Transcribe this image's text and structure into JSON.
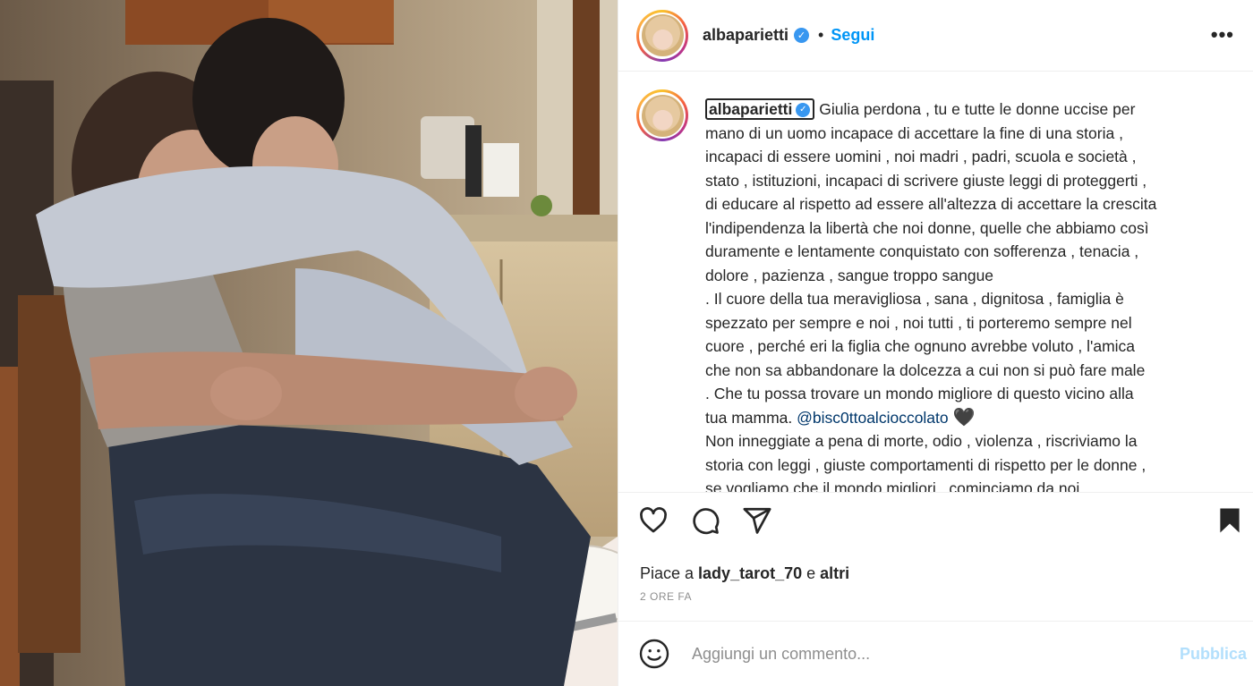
{
  "post": {
    "username": "albaparietti",
    "separator": "•",
    "follow_label": "Segui",
    "more_label": "•••"
  },
  "caption": {
    "username": "albaparietti",
    "lines": [
      "Giulia perdona , tu e tutte le donne uccise per",
      "mano di un uomo incapace di accettare la fine di una storia ,",
      "incapaci di essere uomini , noi madri , padri, scuola e società ,",
      "stato , istituzioni, incapaci di scrivere giuste leggi di proteggerti ,",
      "di educare al rispetto ad essere all'altezza di accettare la crescita",
      "l'indipendenza la libertà che noi donne, quelle che abbiamo così",
      "duramente e lentamente conquistato con sofferenza , tenacia ,",
      "dolore , pazienza , sangue troppo sangue",
      ". Il cuore della tua meravigliosa , sana , dignitosa , famiglia è",
      "spezzato per sempre e noi , noi tutti , ti porteremo sempre nel",
      "cuore , perché eri la figlia che ognuno avrebbe voluto , l'amica",
      "che non sa abbandonare la dolcezza a cui non si può fare male",
      ". Che tu possa trovare un mondo migliore di questo vicino alla"
    ],
    "line14_text": "tua mamma. ",
    "mention": "@bisc0ttoalcioccolato",
    "heart": "🖤",
    "lines_after": [
      "Non inneggiate a pena di morte, odio , violenza , riscriviamo la",
      "storia con leggi , giuste comportamenti di rispetto per le donne ,",
      "se vogliamo che il mondo migliori , cominciamo da noi"
    ]
  },
  "likes": {
    "prefix": "Piace a ",
    "user": "lady_tarot_70",
    "middle": " e ",
    "others": "altri"
  },
  "timestamp": "2 ORE FA",
  "comment": {
    "placeholder": "Aggiungi un commento...",
    "publish_label": "Pubblica"
  },
  "colors": {
    "link_blue": "#0095f6",
    "verified_blue": "#3897f0",
    "publish_disabled": "#b2dffc",
    "text": "#262626",
    "muted": "#8e8e8e"
  },
  "icons": [
    "heart-icon",
    "comment-icon",
    "share-icon",
    "bookmark-icon",
    "emoji-icon",
    "verified-badge-icon",
    "more-options-icon"
  ]
}
